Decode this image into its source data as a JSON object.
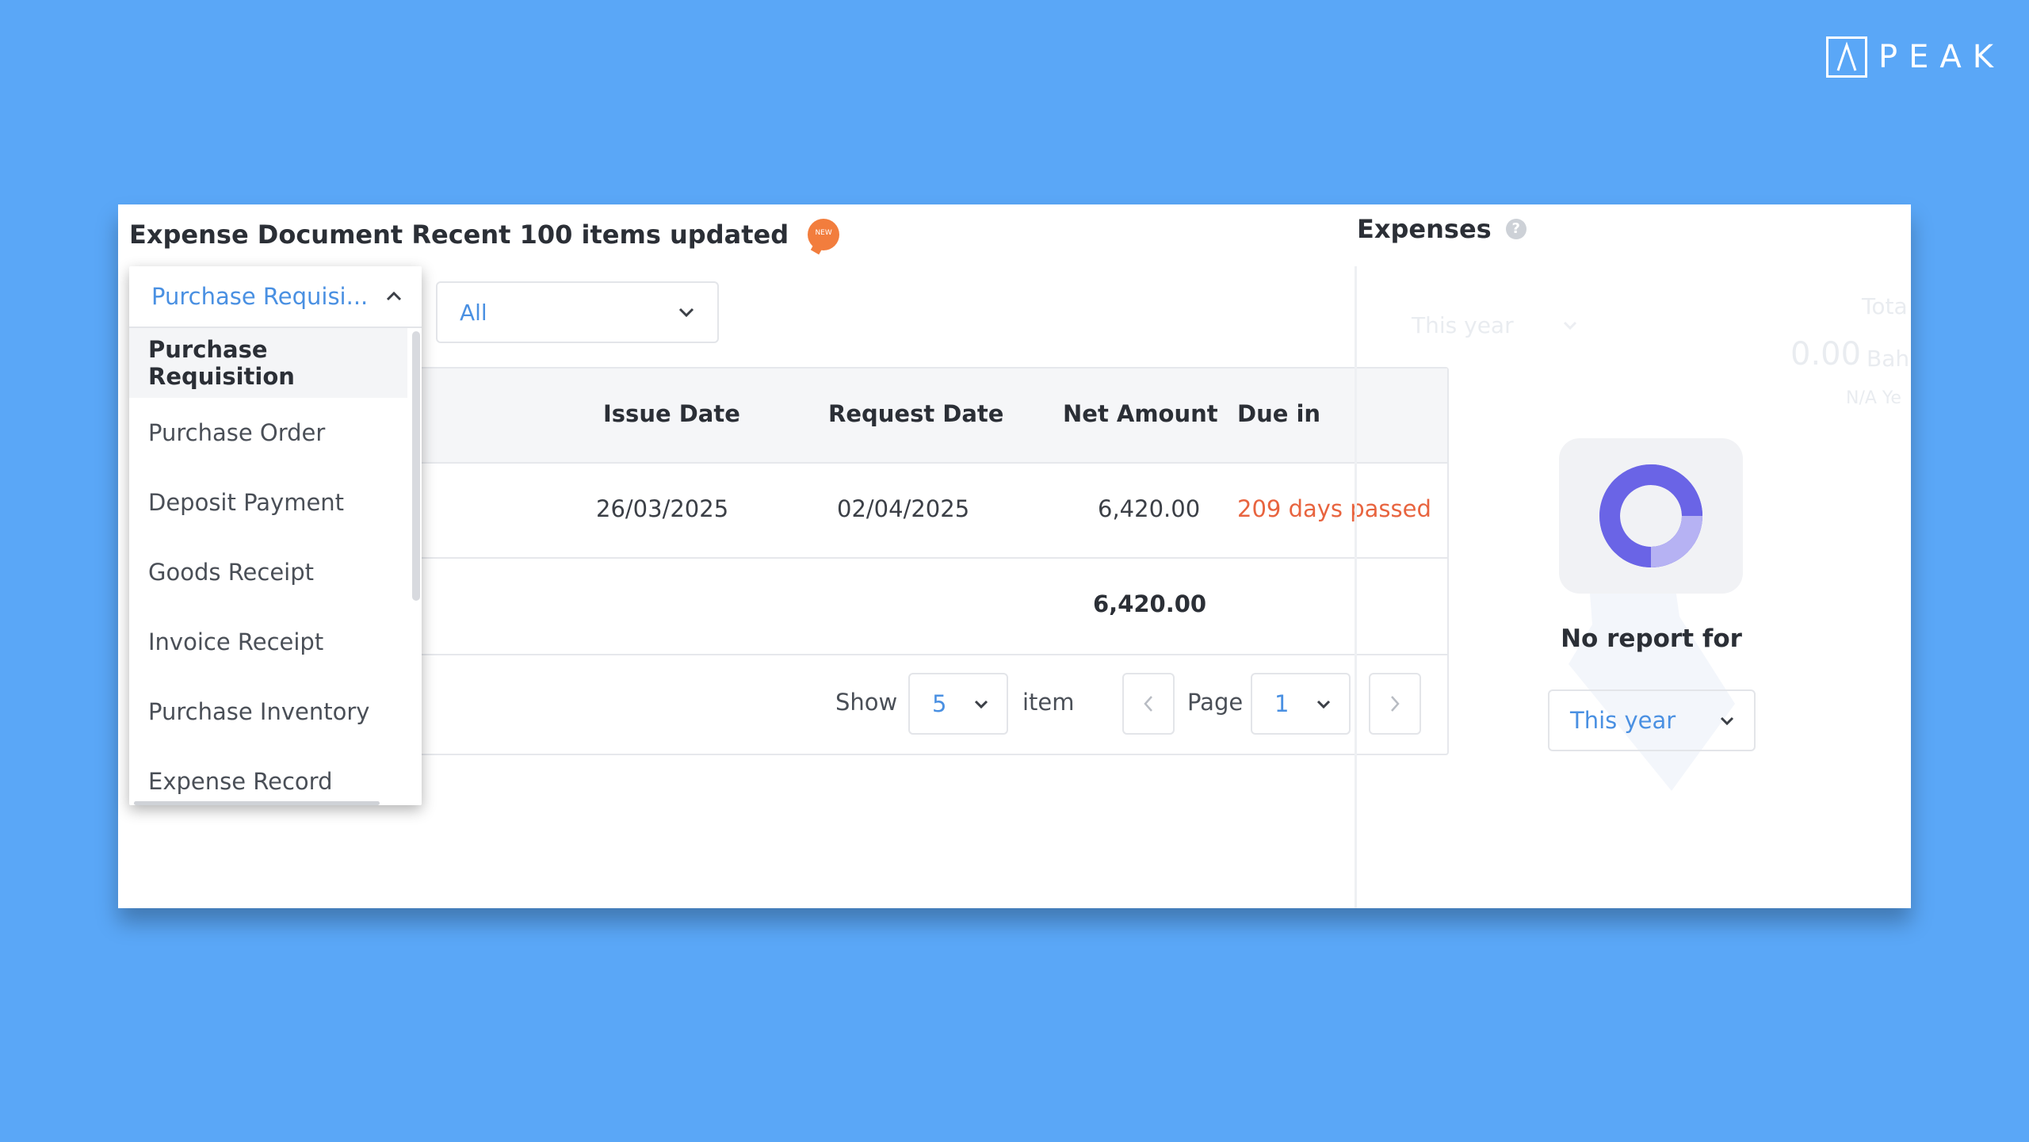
{
  "brand": {
    "logo_text": "PEAK"
  },
  "recent_docs": {
    "title": "Expense Document Recent 100 items updated",
    "new_badge": "NEW",
    "doc_type_select": {
      "value": "Purchase Requisi...",
      "options": [
        "Purchase Requisition",
        "Purchase Order",
        "Deposit Payment",
        "Goods Receipt",
        "Invoice Receipt",
        "Purchase Inventory",
        "Expense Record"
      ],
      "active_index": 0
    },
    "status_select": {
      "value": "All"
    },
    "table": {
      "headers": [
        "Issue Date",
        "Request Date",
        "Net Amount",
        "Due in"
      ],
      "rows": [
        {
          "issue_date": "26/03/2025",
          "request_date": "02/04/2025",
          "net_amount": "6,420.00",
          "due_in": "209 days passed"
        }
      ],
      "total": "6,420.00"
    },
    "pagination": {
      "show_label": "Show",
      "page_size": "5",
      "item_label": "item",
      "page_label": "Page",
      "page": "1"
    }
  },
  "expenses": {
    "title": "Expenses",
    "help": "?",
    "background_hint": {
      "period": "This year",
      "total_label": "Tota",
      "amount": "0.00",
      "unit": "Bah",
      "sub": "N/A Ye"
    },
    "empty_message": "No report for",
    "period_select": {
      "value": "This year"
    }
  },
  "colors": {
    "background": "#5aa7f7",
    "accent": "#4a90e2",
    "overdue": "#e8643f",
    "donut_main": "#6a64e6",
    "donut_light": "#b6b2f3"
  }
}
